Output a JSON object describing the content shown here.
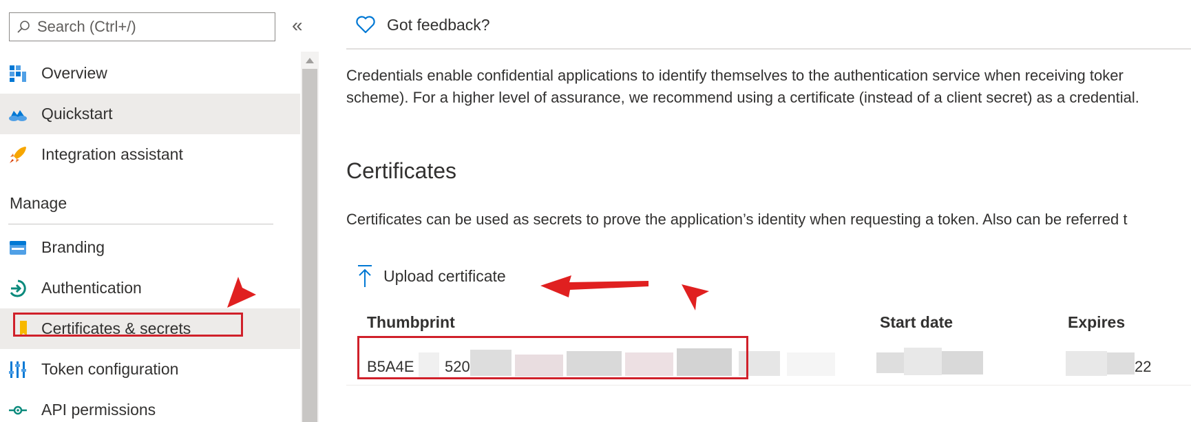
{
  "sidebar": {
    "search_placeholder": "Search (Ctrl+/)",
    "collapse_glyph": "«",
    "items": [
      {
        "label": "Overview",
        "icon": "overview-icon"
      },
      {
        "label": "Quickstart",
        "icon": "quickstart-icon"
      },
      {
        "label": "Integration assistant",
        "icon": "rocket-icon"
      }
    ],
    "manage_header": "Manage",
    "manage_items": [
      {
        "label": "Branding",
        "icon": "branding-icon"
      },
      {
        "label": "Authentication",
        "icon": "authentication-icon"
      },
      {
        "label": "Certificates & secrets",
        "icon": "key-icon",
        "selected": true
      },
      {
        "label": "Token configuration",
        "icon": "token-config-icon"
      },
      {
        "label": "API permissions",
        "icon": "api-permissions-icon"
      }
    ]
  },
  "main": {
    "feedback_label": "Got feedback?",
    "description_line1": "Credentials enable confidential applications to identify themselves to the authentication service when receiving toker",
    "description_line2": "scheme). For a higher level of assurance, we recommend using a certificate (instead of a client secret) as a credential.",
    "certificates": {
      "title": "Certificates",
      "description": "Certificates can be used as secrets to prove the application’s identity when requesting a token. Also can be referred t",
      "upload_label": "Upload certificate",
      "columns": [
        "Thumbprint",
        "Start date",
        "Expires"
      ],
      "row": {
        "thumbprint_visible_start": "B5A4E",
        "thumbprint_visible_mid": "520",
        "expires_visible_end": "22"
      }
    }
  },
  "colors": {
    "accent": "#0078d4",
    "annotation_red": "#d0202a",
    "selected_bg": "#edebe9"
  }
}
